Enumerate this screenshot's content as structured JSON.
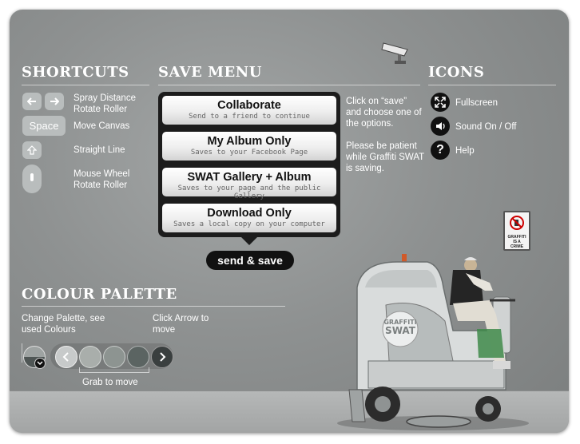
{
  "shortcuts": {
    "heading": "SHORTCUTS",
    "rows": [
      {
        "line1": "Spray Distance",
        "line2": "Rotate Roller"
      },
      {
        "key": "Space",
        "line1": "Move Canvas"
      },
      {
        "line1": "Straight Line"
      },
      {
        "line1": "Mouse Wheel",
        "line2": "Rotate Roller"
      }
    ]
  },
  "save_menu": {
    "heading": "SAVE MENU",
    "options": [
      {
        "title": "Collaborate",
        "subtitle": "Send to a friend to continue"
      },
      {
        "title": "My Album Only",
        "subtitle": "Saves to your Facebook Page"
      },
      {
        "title": "SWAT Gallery + Album",
        "subtitle": "Saves to your page and the public Gallery"
      },
      {
        "title": "Download Only",
        "subtitle": "Saves a local copy on your computer"
      }
    ],
    "send_label": "send & save",
    "help_text_1": "Click on “save” and choose one of the options.",
    "help_text_2": "Please be patient while Graffiti SWAT is saving."
  },
  "icons": {
    "heading": "ICONS",
    "items": [
      {
        "label": "Fullscreen",
        "icon": "fullscreen-icon"
      },
      {
        "label": "Sound On / Off",
        "icon": "sound-icon"
      },
      {
        "label": "Help",
        "icon": "help-icon"
      }
    ]
  },
  "colour_palette": {
    "heading": "COLOUR PALETTE",
    "change_label": "Change Palette, see used Colours",
    "arrow_label": "Click Arrow to move",
    "grab_label": "Grab to move",
    "swatches": [
      "#a9aeab",
      "#8d9491",
      "#5b6462"
    ]
  },
  "scene": {
    "sign_text": "GRAFFITI IS A CRIME",
    "machine_text": "GRAFFITI SWAT"
  }
}
